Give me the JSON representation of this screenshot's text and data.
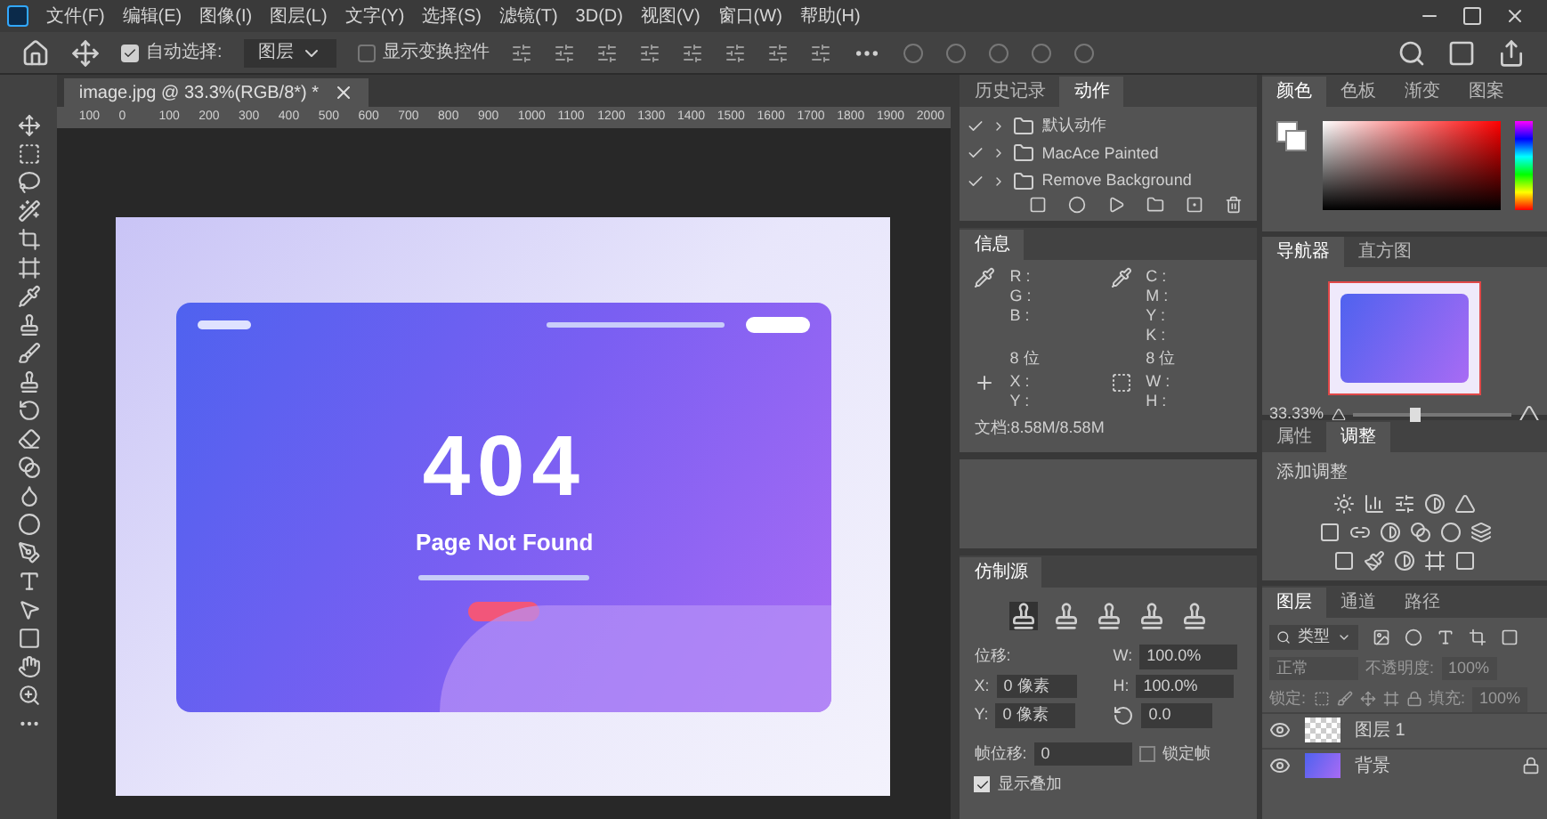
{
  "menu": [
    {
      "label": "文件(F)"
    },
    {
      "label": "编辑(E)"
    },
    {
      "label": "图像(I)"
    },
    {
      "label": "图层(L)"
    },
    {
      "label": "文字(Y)"
    },
    {
      "label": "选择(S)"
    },
    {
      "label": "滤镜(T)"
    },
    {
      "label": "3D(D)"
    },
    {
      "label": "视图(V)"
    },
    {
      "label": "窗口(W)"
    },
    {
      "label": "帮助(H)"
    }
  ],
  "options_bar": {
    "auto_select": {
      "label": "自动选择:",
      "checked": true
    },
    "target": "图层",
    "show_transform": {
      "label": "显示变换控件",
      "checked": false
    }
  },
  "document_tab": {
    "title": "image.jpg @ 33.3%(RGB/8*) *"
  },
  "ruler": {
    "ticks": [
      "100",
      "0",
      "100",
      "200",
      "300",
      "400",
      "500",
      "600",
      "700",
      "800",
      "900",
      "1000",
      "1100",
      "1200",
      "1300",
      "1400",
      "1500",
      "1600",
      "1700",
      "1800",
      "1900",
      "2000"
    ]
  },
  "canvas": {
    "heading": "404",
    "title": "Page Not Found"
  },
  "actions_panel": {
    "tabs": [
      {
        "label": "历史记录",
        "selected": false
      },
      {
        "label": "动作",
        "selected": true
      }
    ],
    "items": [
      {
        "label": "默认动作",
        "checked": true
      },
      {
        "label": "MacAce Painted",
        "checked": true
      },
      {
        "label": "Remove Background",
        "checked": true
      }
    ]
  },
  "info_panel": {
    "tab": "信息",
    "rgb": [
      "R :",
      "G :",
      "B :"
    ],
    "cmyk": [
      "C :",
      "M :",
      "Y :",
      "K :"
    ],
    "bits": [
      "8 位",
      "8 位"
    ],
    "xy": [
      "X :",
      "Y :"
    ],
    "wh": [
      "W :",
      "H :"
    ],
    "doc": "文档:8.58M/8.58M"
  },
  "color_panel": {
    "hue_slider": {
      "level": 1
    },
    "tabs": [
      {
        "label": "颜色",
        "selected": true
      },
      {
        "label": "色板",
        "selected": false
      },
      {
        "label": "渐变",
        "selected": false
      },
      {
        "label": "图案",
        "selected": false
      }
    ]
  },
  "navigator_panel": {
    "tabs": [
      {
        "label": "导航器",
        "selected": true
      },
      {
        "label": "直方图",
        "selected": false
      }
    ],
    "zoom": "33.33%",
    "level": 0.4
  },
  "adjustments_panel": {
    "tabs": [
      {
        "label": "属性",
        "selected": false
      },
      {
        "label": "调整",
        "selected": true
      }
    ],
    "heading": "添加调整"
  },
  "clone_source_panel": {
    "tab": "仿制源",
    "offset_label": "位移:",
    "x_label": "X:",
    "x_value": "0 像素",
    "y_label": "Y:",
    "y_value": "0 像素",
    "w_label": "W:",
    "w_value": "100.0%",
    "h_label": "H:",
    "h_value": "100.0%",
    "angle_value": "0.0",
    "frame_offset_label": "帧位移:",
    "frame_offset_value": "0",
    "lock_frame": {
      "label": "锁定帧",
      "checked": false
    },
    "show_overlay": {
      "label": "显示叠加",
      "checked": true
    }
  },
  "layers_panel": {
    "tabs": [
      {
        "label": "图层",
        "selected": true
      },
      {
        "label": "通道",
        "selected": false
      },
      {
        "label": "路径",
        "selected": false
      }
    ],
    "filter": "类型",
    "blend_mode": "正常",
    "opacity_label": "不透明度:",
    "opacity_value": "100%",
    "lock_label": "锁定:",
    "fill_label": "填充:",
    "fill_value": "100%",
    "layers": [
      {
        "name": "图层 1",
        "visible": true,
        "kind": "transparent",
        "locked": false
      },
      {
        "name": "背景",
        "visible": true,
        "kind": "image",
        "locked": true
      }
    ]
  }
}
